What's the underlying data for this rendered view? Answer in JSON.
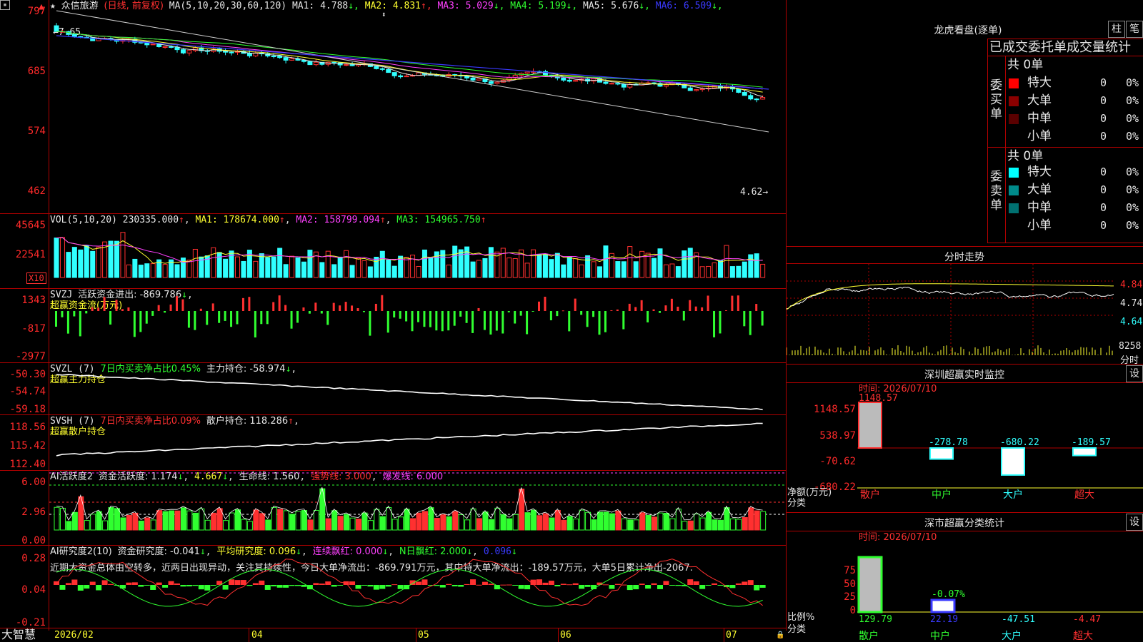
{
  "main": {
    "stock_name": "众信旅游",
    "mode": "(日线, 前复权)",
    "ma_label": "MA(5,10,20,30,60,120)",
    "ma": [
      {
        "name": "MA1:",
        "value": "4.788",
        "arrow": "↓",
        "color": "#e6e6e6"
      },
      {
        "name": "MA2:",
        "value": "4.831",
        "arrow": "↑",
        "color": "#ffff30"
      },
      {
        "name": "MA3:",
        "value": "5.029",
        "arrow": "↓",
        "color": "#ff40ff"
      },
      {
        "name": "MA4:",
        "value": "5.199",
        "arrow": "↓",
        "color": "#30ff30"
      },
      {
        "name": "MA5:",
        "value": "5.676",
        "arrow": "↓",
        "color": "#e6e6e6"
      },
      {
        "name": "MA6:",
        "value": "6.509",
        "arrow": "↓",
        "color": "#3a3aff"
      }
    ],
    "y_ticks": [
      "797",
      "685",
      "574",
      "462"
    ],
    "high_mark": "7.65",
    "low_mark": "4.62"
  },
  "vol": {
    "label": "VOL(5,10,20)",
    "value": "230335.000",
    "ma1": "MA1: 178674.000",
    "ma2": "MA2: 158799.094",
    "ma3": "MA3: 154965.750",
    "y_ticks": [
      "45645",
      "22541"
    ],
    "unit": "X10"
  },
  "svzj": {
    "label": "SVZJ",
    "text": "活跃资金进出: -869.786",
    "arrow": "↓",
    "subtitle": "超赢资金流(万元)",
    "y_ticks": [
      "1343",
      "-817",
      "-2977"
    ]
  },
  "svzl": {
    "label": "SVZL (7)",
    "text1": "7日内买卖净占比0.45%",
    "text2": "主力持仓: -58.974",
    "arrow": "↓",
    "subtitle": "超赢主力持仓",
    "y_ticks": [
      "-50.30",
      "-54.74",
      "-59.18"
    ]
  },
  "svsh": {
    "label": "SVSH (7)",
    "text1": "7日内买卖净占比0.09%",
    "text2": "散户持仓: 118.286",
    "arrow": "↑",
    "subtitle": "超赢散户持仓",
    "y_ticks": [
      "118.56",
      "115.42",
      "112.40"
    ]
  },
  "ai1": {
    "label": "AI活跃度2",
    "t1": "资金活跃度: 1.174",
    "t2": "4.667",
    "t3": "生命线: 1.560",
    "t4": "强势线: 3.000",
    "t5": "爆发线: 6.000",
    "y_ticks": [
      "6.00",
      "2.96",
      "0.00"
    ]
  },
  "ai2": {
    "label": "AI研究度2(10)",
    "t1": "资金研究度: -0.041",
    "t2": "平均研究度: 0.096",
    "t3": "连续飘红: 0.000",
    "t4": "N日飘红: 2.000",
    "t5": "0.096",
    "comment": "近期大资金总体由空转多，近两日出现异动，关注其持续性，今日大单净流出：-869.791万元，其中特大单净流出：-189.57万元，大单5日累计净出-2067.",
    "y_ticks": [
      "0.28",
      "0.04",
      "-0.21"
    ]
  },
  "footer": {
    "brand": "大智慧",
    "dates": [
      "2026/02",
      "04",
      "05",
      "06",
      "07"
    ]
  },
  "right": {
    "lhb_title": "龙虎看盘(逐单)",
    "btn1": "柱",
    "btn2": "笔",
    "tabs_text": "已成交委托单成交量统计",
    "buy_side": "委买单",
    "sell_side": "委卖单",
    "buy_total": "共 0单",
    "sell_total": "共 0单",
    "buy_rows": [
      {
        "name": "特大",
        "color": "#ff0000",
        "value": "0",
        "pct": "0%"
      },
      {
        "name": "大单",
        "color": "#8b0000",
        "value": "0",
        "pct": "0%"
      },
      {
        "name": "中单",
        "color": "#5a0000",
        "value": "0",
        "pct": "0%"
      },
      {
        "name": "小单",
        "color": "#000000",
        "value": "0",
        "pct": "0%"
      }
    ],
    "sell_rows": [
      {
        "name": "特大",
        "color": "#00ffff",
        "value": "0",
        "pct": "0%"
      },
      {
        "name": "大单",
        "color": "#008b8b",
        "value": "0",
        "pct": "0%"
      },
      {
        "name": "中单",
        "color": "#007070",
        "value": "0",
        "pct": "0%"
      },
      {
        "name": "小单",
        "color": "#000000",
        "value": "0",
        "pct": "0%"
      }
    ],
    "intraday_title": "分时走势",
    "intraday_ticks": [
      "4.840",
      "4.740",
      "4.640"
    ],
    "intraday_vol": "8258",
    "intraday_vol_label": "分时",
    "sz_title": "深圳超赢实时监控",
    "sz_btn": "设",
    "sz_time": "时间: 2026/07/10",
    "sz_ticks": [
      "1148.57",
      "538.97",
      "-70.62",
      "-680.22"
    ],
    "sz_unit": "净额(万元)",
    "sz_cat": "分类",
    "sz_bars": [
      {
        "name": "散户",
        "value": "1148.57",
        "num": 1148.57
      },
      {
        "name": "中户",
        "value": "-278.78",
        "num": -278.78
      },
      {
        "name": "大户",
        "value": "-680.22",
        "num": -680.22
      },
      {
        "name": "超大",
        "value": "-189.57",
        "num": -189.57
      }
    ],
    "cls_title": "深市超赢分类统计",
    "cls_btn": "设",
    "cls_time": "时间: 2026/07/10",
    "cls_ticks": [
      "75",
      "50",
      "25",
      "0"
    ],
    "cls_unit": "比例%",
    "cls_cat": "分类",
    "cls_peak": "-0.07%",
    "cls_bars": [
      {
        "name": "散户",
        "value": "129.79"
      },
      {
        "name": "中户",
        "value": "22.19"
      },
      {
        "name": "大户",
        "value": "-47.51"
      },
      {
        "name": "超大",
        "value": "-4.47"
      }
    ]
  },
  "colors": {
    "up": "#ff3030",
    "down": "#30ffff",
    "grid": "#b00000",
    "green": "#30ff30"
  }
}
